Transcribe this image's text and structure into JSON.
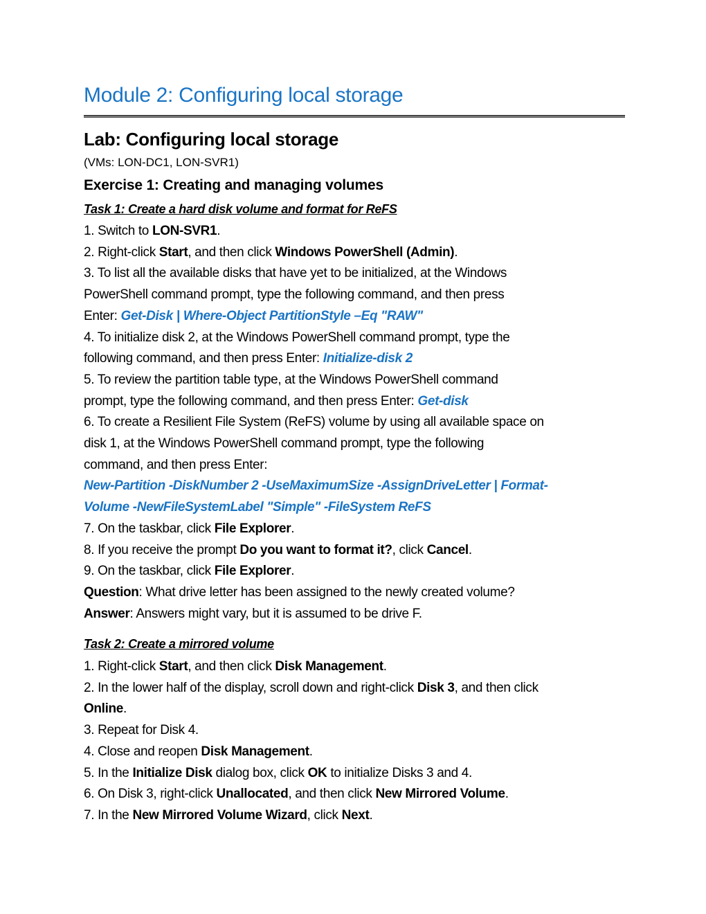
{
  "module_title": "Module 2: Configuring local storage",
  "lab_title": "Lab: Configuring local storage",
  "vms": "(VMs: LON-DC1, LON-SVR1)",
  "exercise_title": "Exercise 1: Creating and managing volumes",
  "accent_color": "#1a74c4",
  "task1": {
    "title": "Task 1: Create a hard disk volume and format for ReFS",
    "lines": [
      [
        {
          "t": "1. Switch to "
        },
        {
          "t": "LON-SVR1",
          "s": "b"
        },
        {
          "t": "."
        }
      ],
      [
        {
          "t": "2. Right-click "
        },
        {
          "t": "Start",
          "s": "b"
        },
        {
          "t": ", and then click "
        },
        {
          "t": "Windows PowerShell (Admin)",
          "s": "b"
        },
        {
          "t": "."
        }
      ],
      [
        {
          "t": "3. To list all the available disks that have yet to be initialized, at the Windows"
        }
      ],
      [
        {
          "t": "PowerShell command prompt, type the following command, and then press"
        }
      ],
      [
        {
          "t": "Enter: "
        },
        {
          "t": "Get-Disk | Where-Object PartitionStyle –Eq \"RAW\"",
          "s": "cmd"
        }
      ],
      [
        {
          "t": "4. To initialize disk 2, at the Windows PowerShell command prompt, type the"
        }
      ],
      [
        {
          "t": "following command, and then press Enter: "
        },
        {
          "t": "Initialize-disk 2",
          "s": "cmd"
        }
      ],
      [
        {
          "t": "5. To review the partition table type, at the Windows PowerShell command"
        }
      ],
      [
        {
          "t": "prompt, type the following command, and then press Enter: "
        },
        {
          "t": "Get-disk",
          "s": "cmd"
        }
      ],
      [
        {
          "t": "6. To create a Resilient File System (ReFS) volume by using all available space on"
        }
      ],
      [
        {
          "t": "disk 1, at the Windows PowerShell command prompt, type the following"
        }
      ],
      [
        {
          "t": "command, and then press Enter:"
        }
      ],
      [
        {
          "t": "New-Partition -DiskNumber 2 -UseMaximumSize -AssignDriveLetter | Format-",
          "s": "cmd"
        }
      ],
      [
        {
          "t": "Volume -NewFileSystemLabel \"Simple\" -FileSystem ReFS",
          "s": "cmd"
        }
      ],
      [
        {
          "t": "7. On the taskbar, click "
        },
        {
          "t": "File Explorer",
          "s": "b"
        },
        {
          "t": "."
        }
      ],
      [
        {
          "t": "8. If you receive the prompt "
        },
        {
          "t": "Do you want to format it?",
          "s": "b"
        },
        {
          "t": ", click "
        },
        {
          "t": "Cancel",
          "s": "b"
        },
        {
          "t": "."
        }
      ],
      [
        {
          "t": "9. On the taskbar, click "
        },
        {
          "t": "File Explorer",
          "s": "b"
        },
        {
          "t": "."
        }
      ],
      [
        {
          "t": "Question",
          "s": "b"
        },
        {
          "t": ": What drive letter has been assigned to the newly created volume?"
        }
      ],
      [
        {
          "t": "Answer",
          "s": "b"
        },
        {
          "t": ": Answers might vary, but it is assumed to be drive F."
        }
      ]
    ]
  },
  "task2": {
    "title": "Task 2: Create a mirrored volume",
    "lines": [
      [
        {
          "t": "1. Right-click "
        },
        {
          "t": "Start",
          "s": "b"
        },
        {
          "t": ", and then click "
        },
        {
          "t": "Disk Management",
          "s": "b"
        },
        {
          "t": "."
        }
      ],
      [
        {
          "t": "2. In the lower half of the display, scroll down and right-click "
        },
        {
          "t": "Disk 3",
          "s": "b"
        },
        {
          "t": ", and then click"
        }
      ],
      [
        {
          "t": "Online",
          "s": "b"
        },
        {
          "t": "."
        }
      ],
      [
        {
          "t": "3. Repeat for Disk 4."
        }
      ],
      [
        {
          "t": "4. Close and reopen "
        },
        {
          "t": "Disk Management",
          "s": "b"
        },
        {
          "t": "."
        }
      ],
      [
        {
          "t": "5. In the "
        },
        {
          "t": "Initialize Disk",
          "s": "b"
        },
        {
          "t": " dialog box, click "
        },
        {
          "t": "OK",
          "s": "b"
        },
        {
          "t": " to initialize Disks 3 and 4."
        }
      ],
      [
        {
          "t": "6. On Disk 3, right-click "
        },
        {
          "t": "Unallocated",
          "s": "b"
        },
        {
          "t": ", and then click "
        },
        {
          "t": "New Mirrored Volume",
          "s": "b"
        },
        {
          "t": "."
        }
      ],
      [
        {
          "t": "7. In the "
        },
        {
          "t": "New Mirrored Volume Wizard",
          "s": "b"
        },
        {
          "t": ", click "
        },
        {
          "t": "Next",
          "s": "b"
        },
        {
          "t": "."
        }
      ]
    ]
  }
}
